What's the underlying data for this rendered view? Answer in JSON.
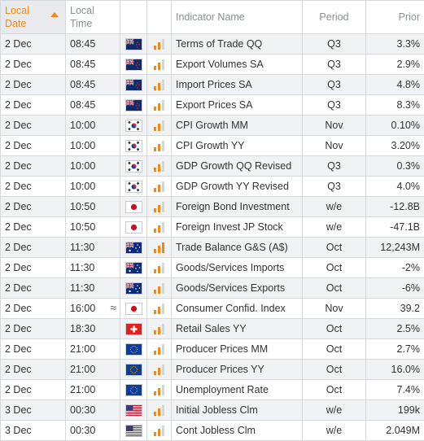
{
  "header": {
    "local_date": "Local Date",
    "local_time": "Local Time",
    "indicator_name": "Indicator Name",
    "period": "Period",
    "prior": "Prior"
  },
  "colors": {
    "accent": "#f08a12",
    "bar_inactive": "#d3d6da",
    "row_alt": "#f1f2f4",
    "border": "#d5d9de"
  },
  "rows": [
    {
      "date": "2 Dec",
      "time": "08:45",
      "holiday": "",
      "flag": "new-zealand-flag",
      "importance": 2,
      "name": "Terms of Trade QQ",
      "period": "Q3",
      "prior": "3.3%"
    },
    {
      "date": "2 Dec",
      "time": "08:45",
      "holiday": "",
      "flag": "new-zealand-flag",
      "importance": 2,
      "name": "Export Volumes SA",
      "period": "Q3",
      "prior": "2.9%"
    },
    {
      "date": "2 Dec",
      "time": "08:45",
      "holiday": "",
      "flag": "new-zealand-flag",
      "importance": 2,
      "name": "Import Prices SA",
      "period": "Q3",
      "prior": "4.8%"
    },
    {
      "date": "2 Dec",
      "time": "08:45",
      "holiday": "",
      "flag": "new-zealand-flag",
      "importance": 2,
      "name": "Export Prices SA",
      "period": "Q3",
      "prior": "8.3%"
    },
    {
      "date": "2 Dec",
      "time": "10:00",
      "holiday": "",
      "flag": "south-korea-flag",
      "importance": 2,
      "name": "CPI Growth MM",
      "period": "Nov",
      "prior": "0.10%"
    },
    {
      "date": "2 Dec",
      "time": "10:00",
      "holiday": "",
      "flag": "south-korea-flag",
      "importance": 2,
      "name": "CPI Growth YY",
      "period": "Nov",
      "prior": "3.20%"
    },
    {
      "date": "2 Dec",
      "time": "10:00",
      "holiday": "",
      "flag": "south-korea-flag",
      "importance": 2,
      "name": "GDP Growth QQ Revised",
      "period": "Q3",
      "prior": "0.3%"
    },
    {
      "date": "2 Dec",
      "time": "10:00",
      "holiday": "",
      "flag": "south-korea-flag",
      "importance": 2,
      "name": "GDP Growth YY Revised",
      "period": "Q3",
      "prior": "4.0%"
    },
    {
      "date": "2 Dec",
      "time": "10:50",
      "holiday": "",
      "flag": "japan-flag",
      "importance": 2,
      "name": "Foreign Bond Investment",
      "period": "w/e",
      "prior": "-12.8B"
    },
    {
      "date": "2 Dec",
      "time": "10:50",
      "holiday": "",
      "flag": "japan-flag",
      "importance": 2,
      "name": "Foreign Invest JP Stock",
      "period": "w/e",
      "prior": "-47.1B"
    },
    {
      "date": "2 Dec",
      "time": "11:30",
      "holiday": "",
      "flag": "australia-flag",
      "importance": 3,
      "name": "Trade Balance G&S (A$)",
      "period": "Oct",
      "prior": "12,243M"
    },
    {
      "date": "2 Dec",
      "time": "11:30",
      "holiday": "",
      "flag": "australia-flag",
      "importance": 2,
      "name": "Goods/Services Imports",
      "period": "Oct",
      "prior": "-2%"
    },
    {
      "date": "2 Dec",
      "time": "11:30",
      "holiday": "",
      "flag": "australia-flag",
      "importance": 2,
      "name": "Goods/Services Exports",
      "period": "Oct",
      "prior": "-6%"
    },
    {
      "date": "2 Dec",
      "time": "16:00",
      "holiday": "≈",
      "flag": "japan-flag",
      "importance": 2,
      "name": "Consumer Confid. Index",
      "period": "Nov",
      "prior": "39.2"
    },
    {
      "date": "2 Dec",
      "time": "18:30",
      "holiday": "",
      "flag": "switzerland-flag",
      "importance": 2,
      "name": "Retail Sales YY",
      "period": "Oct",
      "prior": "2.5%"
    },
    {
      "date": "2 Dec",
      "time": "21:00",
      "holiday": "",
      "flag": "eurozone-flag",
      "importance": 2,
      "name": "Producer Prices MM",
      "period": "Oct",
      "prior": "2.7%"
    },
    {
      "date": "2 Dec",
      "time": "21:00",
      "holiday": "",
      "flag": "eurozone-flag",
      "importance": 2,
      "name": "Producer Prices YY",
      "period": "Oct",
      "prior": "16.0%"
    },
    {
      "date": "2 Dec",
      "time": "21:00",
      "holiday": "",
      "flag": "eurozone-flag",
      "importance": 2,
      "name": "Unemployment Rate",
      "period": "Oct",
      "prior": "7.4%"
    },
    {
      "date": "3 Dec",
      "time": "00:30",
      "holiday": "",
      "flag": "united-states-flag",
      "importance": 2,
      "name": "Initial Jobless Clm",
      "period": "w/e",
      "prior": "199k"
    },
    {
      "date": "3 Dec",
      "time": "00:30",
      "holiday": "",
      "flag": "united-states-flag",
      "importance": 2,
      "name": "Cont Jobless Clm",
      "period": "w/e",
      "prior": "2.049M"
    }
  ]
}
